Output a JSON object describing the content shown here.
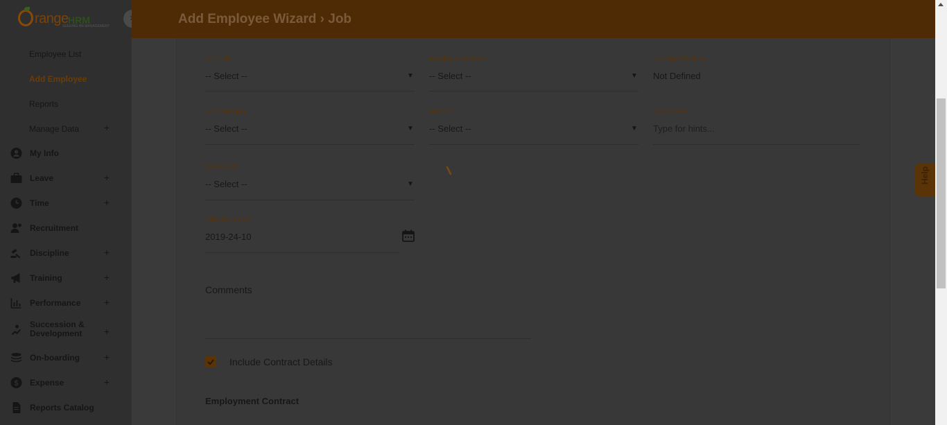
{
  "brand": {
    "logo_text_1": "range",
    "logo_text_2": "HRM",
    "logo_tagline": "SEEKING HR MANAGEMENT"
  },
  "sidebar": {
    "close": "×",
    "subitems": [
      {
        "label": "Employee List"
      },
      {
        "label": "Add Employee",
        "active": true
      },
      {
        "label": "Reports"
      },
      {
        "label": "Manage Data",
        "expandable": "+"
      }
    ],
    "items": [
      {
        "label": "My Info",
        "icon": "user-icon"
      },
      {
        "label": "Leave",
        "icon": "briefcase-icon",
        "expandable": "+"
      },
      {
        "label": "Time",
        "icon": "clock-icon",
        "expandable": "+"
      },
      {
        "label": "Recruitment",
        "icon": "recruitment-icon"
      },
      {
        "label": "Discipline",
        "icon": "discipline-icon",
        "expandable": "+"
      },
      {
        "label": "Training",
        "icon": "megaphone-icon",
        "expandable": "+"
      },
      {
        "label": "Performance",
        "icon": "chart-icon",
        "expandable": "+"
      },
      {
        "label": "Succession &\nDevelopment",
        "icon": "succession-icon",
        "expandable": "+"
      },
      {
        "label": "On-boarding",
        "icon": "stack-icon",
        "expandable": "+"
      },
      {
        "label": "Expense",
        "icon": "dollar-icon",
        "expandable": "+"
      },
      {
        "label": "Reports Catalog",
        "icon": "document-icon"
      }
    ]
  },
  "header": {
    "title": "Add Employee Wizard › Job"
  },
  "form": {
    "job_title": {
      "label": "Job Title",
      "value": "-- Select --"
    },
    "employment_status": {
      "label": "Employment Status",
      "value": "-- Select --"
    },
    "job_specification": {
      "label": "Job Specification",
      "value": "Not Defined"
    },
    "job_category": {
      "label": "Job Category",
      "value": "-- Select --"
    },
    "sub_unit": {
      "label": "Sub Unit",
      "value": "-- Select --"
    },
    "cost_center": {
      "label": "Cost Center",
      "placeholder": "Type for hints..."
    },
    "work_shift": {
      "label": "Work Shift",
      "value": "-- Select --"
    },
    "effective_from": {
      "label": "Effective From",
      "required": "*",
      "value": "2019-24-10"
    },
    "comments": {
      "label": "Comments"
    },
    "include_contract": {
      "label": "Include Contract Details",
      "checked": true
    },
    "section_title": "Employment Contract"
  },
  "help": {
    "label": "Help"
  },
  "colors": {
    "accent": "#5a3307",
    "overlay_bg": "#3a3a3a"
  }
}
